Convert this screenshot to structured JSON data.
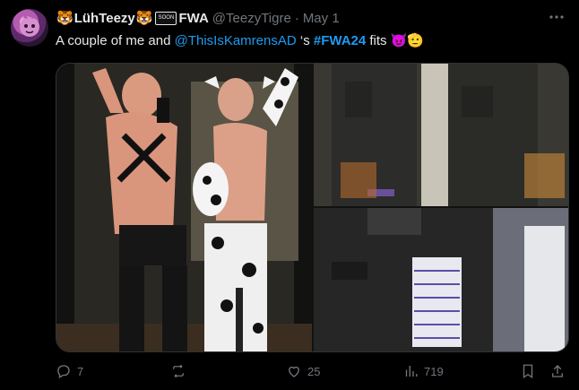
{
  "author": {
    "display_name": "LühTeezy",
    "emoji_before": "🐯",
    "emoji_after": "🐯",
    "soon_badge": "SOON",
    "badge_label": "FWA",
    "handle": "@TeezyTigre",
    "separator": "·",
    "date": "May 1"
  },
  "tweet": {
    "text_part1": "A couple of me and ",
    "mention": "@ThisIsKamrensAD",
    "text_part2": " ‘s ",
    "hashtag": "#FWA24",
    "text_part3": " fits",
    "emojis": "😈🫡"
  },
  "actions": {
    "replies": "7",
    "retweets": "",
    "likes": "25",
    "views": "719"
  },
  "colors": {
    "background": "#000000",
    "text": "#e7e9ea",
    "muted": "#71767b",
    "link": "#1d9bf0"
  }
}
